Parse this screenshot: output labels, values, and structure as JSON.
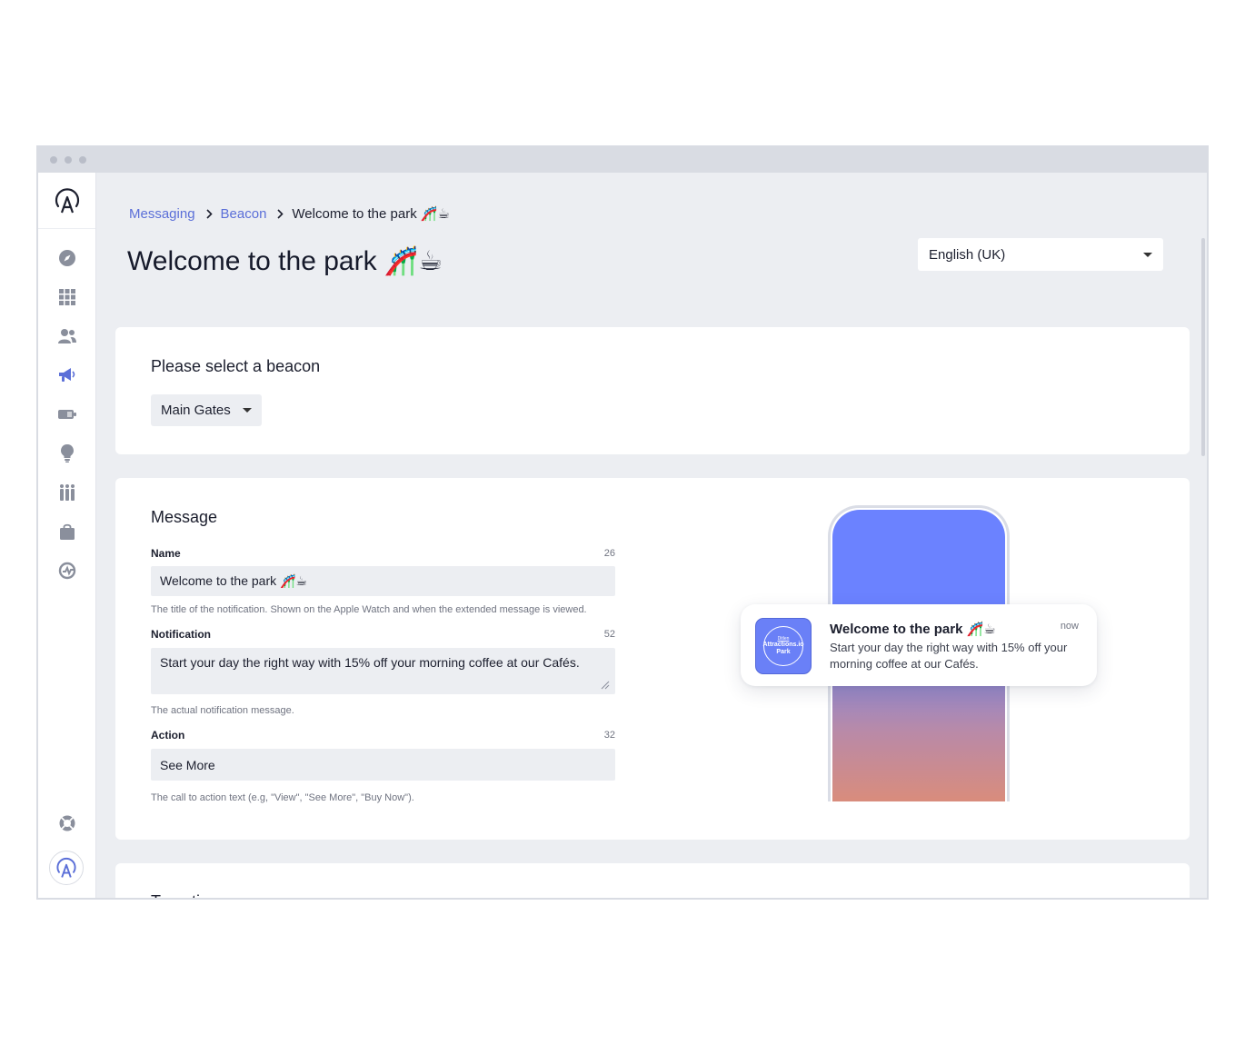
{
  "breadcrumb": {
    "items": [
      "Messaging",
      "Beacon"
    ],
    "current": "Welcome to the park 🎢☕"
  },
  "page": {
    "title": "Welcome to the park 🎢☕",
    "language": "English (UK)"
  },
  "beacon": {
    "heading": "Please select a beacon",
    "selected": "Main Gates"
  },
  "message": {
    "heading": "Message",
    "name": {
      "label": "Name",
      "count": "26",
      "value": "Welcome to the park 🎢☕",
      "help": "The title of the notification. Shown on the Apple Watch and when the extended message is viewed."
    },
    "notification": {
      "label": "Notification",
      "count": "52",
      "value": "Start your day the right way with 15% off your morning coffee at our Cafés.",
      "help": "The actual notification message."
    },
    "action": {
      "label": "Action",
      "count": "32",
      "value": "See More",
      "help": "The call to action text (e.g, \"View\", \"See More\", \"Buy Now\")."
    }
  },
  "preview": {
    "app_icon_small": "Ditlen",
    "app_icon_text": "Attractions.io Park",
    "title": "Welcome to the park 🎢☕",
    "time": "now",
    "body": "Start your day the right way with 15% off your morning coffee at our Cafés."
  },
  "targeting": {
    "heading": "Targeting"
  },
  "sidebar": {
    "icons": [
      "logo-icon",
      "compass-icon",
      "grid-icon",
      "users-icon",
      "megaphone-icon",
      "beacon-device-icon",
      "lightbulb-icon",
      "queue-icon",
      "shopping-bag-icon",
      "analytics-icon",
      "help-lifebuoy-icon",
      "account-avatar-icon"
    ],
    "active": "megaphone-icon"
  },
  "colors": {
    "accent": "#5b6fd8",
    "sidebar_icon": "#8a8f9c",
    "background": "#eceef2"
  }
}
